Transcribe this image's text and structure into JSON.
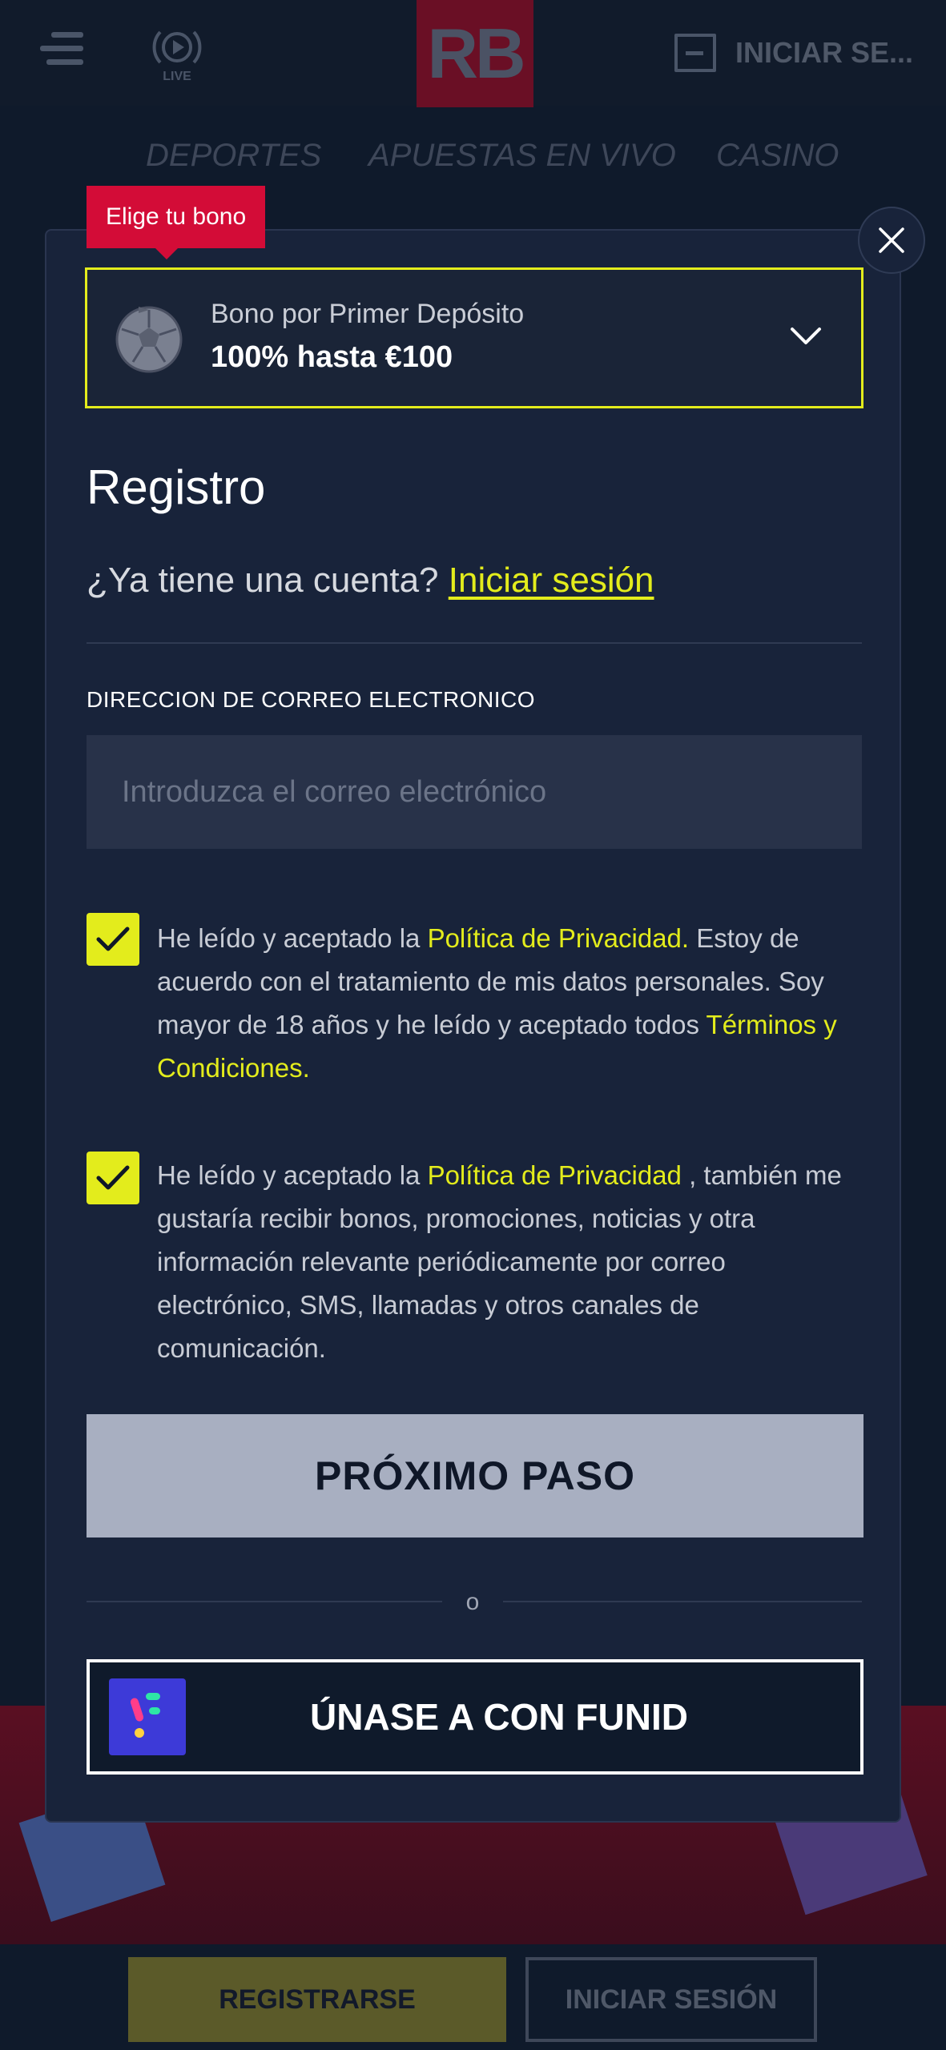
{
  "header": {
    "logo": "RB",
    "live_label": "LIVE",
    "login_label": "INICIAR SE..."
  },
  "nav": {
    "tabs": [
      "DEPORTES",
      "APUESTAS EN VIVO",
      "CASINO"
    ]
  },
  "modal": {
    "bonus_tag": "Elige tu bono",
    "bonus": {
      "line1": "Bono por Primer Depósito",
      "line2": "100% hasta €100",
      "icon": "soccer-ball-icon"
    },
    "title": "Registro",
    "account_question": "¿Ya tiene una cuenta?",
    "login_link": "Iniciar sesión",
    "email": {
      "label": "DIRECCION DE CORREO ELECTRONICO",
      "placeholder": "Introduzca el correo electrónico",
      "value": ""
    },
    "consent1": {
      "checked": true,
      "text1": "He leído y aceptado la ",
      "link1": "Política de Privacidad.",
      "text2": " Estoy de acuerdo con el tratamiento de mis datos personales. Soy mayor de 18 años y he leído y aceptado todos ",
      "link2": "Términos y Condiciones."
    },
    "consent2": {
      "checked": true,
      "text1": "He leído y aceptado la ",
      "link1": " Política de Privacidad",
      "text2": " , también me gustaría recibir bonos, promociones, noticias y otra información relevante periódicamente por correo electrónico, SMS, llamadas y otros canales de comunicación."
    },
    "next_button": "PRÓXIMO PASO",
    "or_text": "o",
    "funid_button": "ÚNASE A CON FUNID"
  },
  "bottom_bar": {
    "register": "REGISTRARSE",
    "login": "INICIAR SESIÓN"
  },
  "colors": {
    "accent": "#e3ec1c",
    "brand_red": "#d30c37",
    "modal_bg": "#18233a",
    "page_bg": "#0f1a2b"
  }
}
